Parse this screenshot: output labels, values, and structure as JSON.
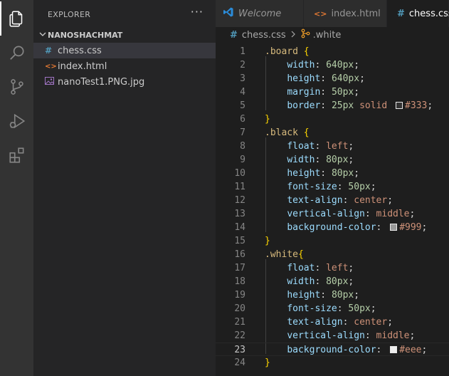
{
  "activity_bar": {
    "icons": [
      "explorer-icon",
      "search-icon",
      "source-control-icon",
      "run-debug-icon",
      "extensions-icon"
    ]
  },
  "sidebar": {
    "header": "EXPLORER",
    "more": "···",
    "folder": "NANOSHACHMAT",
    "files": [
      {
        "name": "chess.css",
        "icon": "#",
        "color": "#519aba",
        "selected": true
      },
      {
        "name": "index.html",
        "icon": "<>",
        "color": "#e37933",
        "selected": false
      },
      {
        "name": "nanoTest1.PNG.jpg",
        "icon": "image",
        "color": "#a074c4",
        "selected": false
      }
    ]
  },
  "tabs": [
    {
      "label": "Welcome",
      "icon": "vscode",
      "active": false,
      "italic": true
    },
    {
      "label": "index.html",
      "icon": "<>",
      "active": false,
      "italic": false
    },
    {
      "label": "chess.css",
      "icon": "#",
      "active": true,
      "italic": false
    }
  ],
  "breadcrumb": {
    "file": "chess.css",
    "symbol": ".white"
  },
  "editor": {
    "current_line": 23,
    "lines": [
      {
        "n": "1",
        "tokens": [
          [
            "sel",
            ".board"
          ],
          [
            "punc",
            " "
          ],
          [
            "brace",
            "{"
          ]
        ]
      },
      {
        "n": "2",
        "tokens": [
          [
            "punc",
            "    "
          ],
          [
            "prop",
            "width"
          ],
          [
            "punc",
            ": "
          ],
          [
            "num",
            "640px"
          ],
          [
            "punc",
            ";"
          ]
        ]
      },
      {
        "n": "3",
        "tokens": [
          [
            "punc",
            "    "
          ],
          [
            "prop",
            "height"
          ],
          [
            "punc",
            ": "
          ],
          [
            "num",
            "640px"
          ],
          [
            "punc",
            ";"
          ]
        ]
      },
      {
        "n": "4",
        "tokens": [
          [
            "punc",
            "    "
          ],
          [
            "prop",
            "margin"
          ],
          [
            "punc",
            ": "
          ],
          [
            "num",
            "50px"
          ],
          [
            "punc",
            ";"
          ]
        ]
      },
      {
        "n": "5",
        "tokens": [
          [
            "punc",
            "    "
          ],
          [
            "prop",
            "border"
          ],
          [
            "punc",
            ": "
          ],
          [
            "num",
            "25px"
          ],
          [
            "punc",
            " "
          ],
          [
            "val",
            "solid"
          ],
          [
            "punc",
            " "
          ],
          [
            "swatch",
            "#333333"
          ],
          [
            "val",
            "#333"
          ],
          [
            "punc",
            ";"
          ]
        ]
      },
      {
        "n": "6",
        "tokens": [
          [
            "brace",
            "}"
          ]
        ]
      },
      {
        "n": "7",
        "tokens": [
          [
            "sel",
            ".black"
          ],
          [
            "punc",
            " "
          ],
          [
            "brace",
            "{"
          ]
        ]
      },
      {
        "n": "8",
        "tokens": [
          [
            "punc",
            "    "
          ],
          [
            "prop",
            "float"
          ],
          [
            "punc",
            ": "
          ],
          [
            "val",
            "left"
          ],
          [
            "punc",
            ";"
          ]
        ]
      },
      {
        "n": "9",
        "tokens": [
          [
            "punc",
            "    "
          ],
          [
            "prop",
            "width"
          ],
          [
            "punc",
            ": "
          ],
          [
            "num",
            "80px"
          ],
          [
            "punc",
            ";"
          ]
        ]
      },
      {
        "n": "10",
        "tokens": [
          [
            "punc",
            "    "
          ],
          [
            "prop",
            "height"
          ],
          [
            "punc",
            ": "
          ],
          [
            "num",
            "80px"
          ],
          [
            "punc",
            ";"
          ]
        ]
      },
      {
        "n": "11",
        "tokens": [
          [
            "punc",
            "    "
          ],
          [
            "prop",
            "font-size"
          ],
          [
            "punc",
            ": "
          ],
          [
            "num",
            "50px"
          ],
          [
            "punc",
            ";"
          ]
        ]
      },
      {
        "n": "12",
        "tokens": [
          [
            "punc",
            "    "
          ],
          [
            "prop",
            "text-align"
          ],
          [
            "punc",
            ": "
          ],
          [
            "val",
            "center"
          ],
          [
            "punc",
            ";"
          ]
        ]
      },
      {
        "n": "13",
        "tokens": [
          [
            "punc",
            "    "
          ],
          [
            "prop",
            "vertical-align"
          ],
          [
            "punc",
            ": "
          ],
          [
            "val",
            "middle"
          ],
          [
            "punc",
            ";"
          ]
        ]
      },
      {
        "n": "14",
        "tokens": [
          [
            "punc",
            "    "
          ],
          [
            "prop",
            "background-color"
          ],
          [
            "punc",
            ": "
          ],
          [
            "swatch",
            "#999999"
          ],
          [
            "val",
            "#999"
          ],
          [
            "punc",
            ";"
          ]
        ]
      },
      {
        "n": "15",
        "tokens": [
          [
            "brace",
            "}"
          ]
        ]
      },
      {
        "n": "16",
        "tokens": [
          [
            "sel",
            ".white"
          ],
          [
            "brace",
            "{"
          ]
        ]
      },
      {
        "n": "17",
        "tokens": [
          [
            "punc",
            "    "
          ],
          [
            "prop",
            "float"
          ],
          [
            "punc",
            ": "
          ],
          [
            "val",
            "left"
          ],
          [
            "punc",
            ";"
          ]
        ]
      },
      {
        "n": "18",
        "tokens": [
          [
            "punc",
            "    "
          ],
          [
            "prop",
            "width"
          ],
          [
            "punc",
            ": "
          ],
          [
            "num",
            "80px"
          ],
          [
            "punc",
            ";"
          ]
        ]
      },
      {
        "n": "19",
        "tokens": [
          [
            "punc",
            "    "
          ],
          [
            "prop",
            "height"
          ],
          [
            "punc",
            ": "
          ],
          [
            "num",
            "80px"
          ],
          [
            "punc",
            ";"
          ]
        ]
      },
      {
        "n": "20",
        "tokens": [
          [
            "punc",
            "    "
          ],
          [
            "prop",
            "font-size"
          ],
          [
            "punc",
            ": "
          ],
          [
            "num",
            "50px"
          ],
          [
            "punc",
            ";"
          ]
        ]
      },
      {
        "n": "21",
        "tokens": [
          [
            "punc",
            "    "
          ],
          [
            "prop",
            "text-align"
          ],
          [
            "punc",
            ": "
          ],
          [
            "val",
            "center"
          ],
          [
            "punc",
            ";"
          ]
        ]
      },
      {
        "n": "22",
        "tokens": [
          [
            "punc",
            "    "
          ],
          [
            "prop",
            "vertical-align"
          ],
          [
            "punc",
            ": "
          ],
          [
            "val",
            "middle"
          ],
          [
            "punc",
            ";"
          ]
        ]
      },
      {
        "n": "23",
        "tokens": [
          [
            "punc",
            "    "
          ],
          [
            "prop",
            "background-color"
          ],
          [
            "punc",
            ": "
          ],
          [
            "swatch",
            "#eeeeee"
          ],
          [
            "val",
            "#eee"
          ],
          [
            "punc",
            ";"
          ]
        ]
      },
      {
        "n": "24",
        "tokens": [
          [
            "brace",
            "}"
          ]
        ]
      }
    ]
  },
  "colors": {
    "activity_bar": "#333333",
    "sidebar": "#252526",
    "editor_bg": "#1e1e1e",
    "selector": "#d7ba7d",
    "property": "#9cdcfe",
    "number": "#b5cea8",
    "string_value": "#ce9178",
    "brace": "#ffd700"
  }
}
